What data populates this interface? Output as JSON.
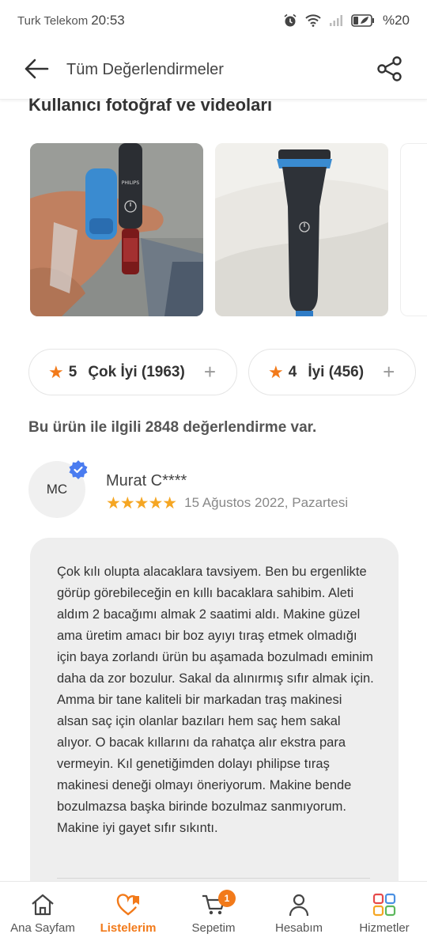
{
  "status_bar": {
    "carrier": "Turk Telekom",
    "time": "20:53",
    "battery": "%20"
  },
  "header": {
    "title": "Tüm Değerlendirmeler"
  },
  "media": {
    "title": "Kullanıcı fotoğraf ve videoları"
  },
  "rating_filters": [
    {
      "stars": "5",
      "label": "Çok İyi (1963)"
    },
    {
      "stars": "4",
      "label": "İyi (456)"
    }
  ],
  "review_count_text": "Bu ürün ile ilgili 2848 değerlendirme var.",
  "review": {
    "initials": "MC",
    "name": "Murat C****",
    "rating": 5,
    "stars": "★★★★★",
    "date": "15 Ağustos 2022, Pazartesi",
    "text": "Çok kılı olupta alacaklara tavsiyem. Ben bu ergenlikte görüp görebileceğin en kıllı bacaklara sahibim. Aleti aldım 2 bacağımı almak 2 saatimi aldı. Makine güzel ama üretim amacı bir boz ayıyı tıraş etmek olmadığı için baya zorlandı ürün bu aşamada bozulmadı eminim daha da zor bozulur. Sakal da alınırmış sıfır almak için. Amma bir tane kaliteli bir markadan traş makinesi alsan saç için olanlar bazıları hem saç hem sakal alıyor. O bacak kıllarını da rahatça alır ekstra para vermeyin. Kıl genetiğimden dolayı philipse tıraş makinesi deneği olmayı öneriyorum. Makine bende bozulmazsa başka birinde bozulmaz sanmıyorum. Makine iyi gayet sıfır sıkıntı."
  },
  "product_brand_text": "PHILIPS",
  "tab_bar": {
    "home": "Ana Sayfam",
    "lists": "Listelerim",
    "cart": "Sepetim",
    "cart_badge": "1",
    "account": "Hesabım",
    "services": "Hizmetler"
  },
  "colors": {
    "accent": "#f27a1a",
    "star": "#f5a623",
    "verified": "#4a7cf0"
  }
}
